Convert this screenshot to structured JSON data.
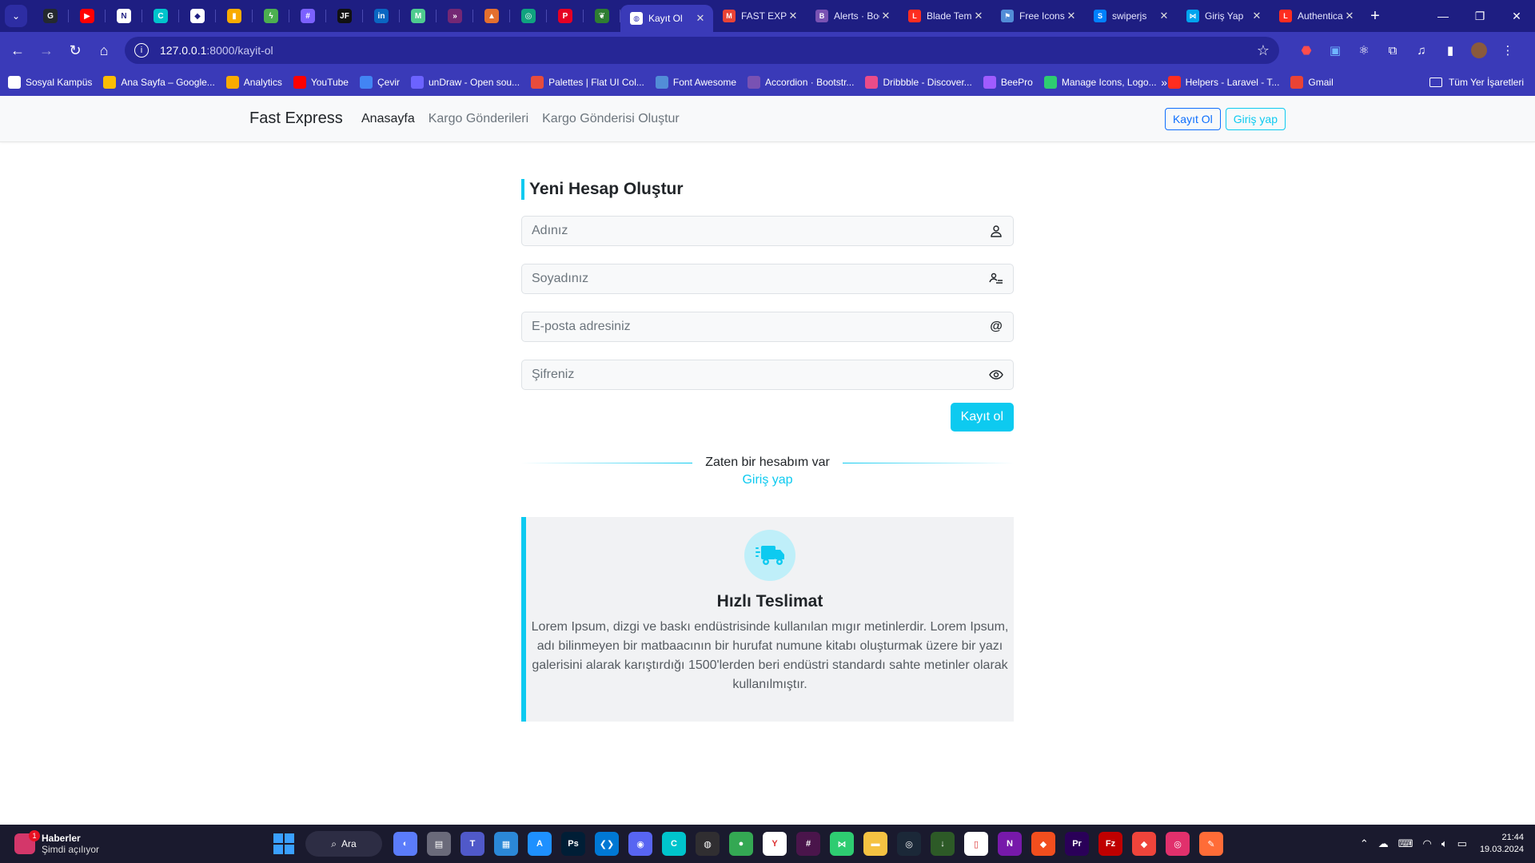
{
  "browser": {
    "pinned_tabs": [
      {
        "icon": "github-icon",
        "color": "#24292f",
        "glyph": "G"
      },
      {
        "icon": "youtube-icon",
        "color": "#ff0000",
        "glyph": "▶"
      },
      {
        "icon": "notion-icon",
        "color": "#ffffff",
        "glyph": "N"
      },
      {
        "icon": "canva-icon",
        "color": "#00c4cc",
        "glyph": "C"
      },
      {
        "icon": "car-icon",
        "color": "#ffffff",
        "glyph": "◆"
      },
      {
        "icon": "analytics-icon",
        "color": "#f9ab00",
        "glyph": "▮"
      },
      {
        "icon": "bolt-icon",
        "color": "#4caf50",
        "glyph": "ϟ"
      },
      {
        "icon": "hashnode-icon",
        "color": "#7b61ff",
        "glyph": "#"
      },
      {
        "icon": "jf-icon",
        "color": "#111111",
        "glyph": "JF"
      },
      {
        "icon": "linkedin-icon",
        "color": "#0a66c2",
        "glyph": "in"
      },
      {
        "icon": "mail-icon",
        "color": "#4ecb8f",
        "glyph": "M"
      },
      {
        "icon": "powerapps-icon",
        "color": "#742774",
        "glyph": "»"
      },
      {
        "icon": "mountain-icon",
        "color": "#e46f2e",
        "glyph": "▲"
      },
      {
        "icon": "chatgpt-icon",
        "color": "#10a37f",
        "glyph": "◎"
      },
      {
        "icon": "pinterest-icon",
        "color": "#e60023",
        "glyph": "P"
      },
      {
        "icon": "leaf-icon",
        "color": "#2e7d32",
        "glyph": "❦"
      }
    ],
    "tabs": [
      {
        "title": "Kayıt Ol",
        "icon": "globe-icon",
        "color": "#ffffff",
        "glyph": "◍",
        "active": true
      },
      {
        "title": "FAST EXPRESS",
        "icon": "gmail-icon",
        "color": "#ea4335",
        "glyph": "M",
        "active": false
      },
      {
        "title": "Alerts · Bootstrap",
        "icon": "bootstrap-icon",
        "color": "#7952b3",
        "glyph": "B",
        "active": false
      },
      {
        "title": "Blade Templates",
        "icon": "laravel-icon",
        "color": "#ff2d20",
        "glyph": "L",
        "active": false
      },
      {
        "title": "Free Icons",
        "icon": "flag-icon",
        "color": "#528dd7",
        "glyph": "⚑",
        "active": false
      },
      {
        "title": "swiperjs",
        "icon": "swiper-icon",
        "color": "#0080ff",
        "glyph": "S",
        "active": false
      },
      {
        "title": "Giriş Yap",
        "icon": "share-icon",
        "color": "#00a4ef",
        "glyph": "⋈",
        "active": false
      },
      {
        "title": "Authentication",
        "icon": "laravel-icon",
        "color": "#ff2d20",
        "glyph": "L",
        "active": false
      }
    ],
    "url_host": "127.0.0.1",
    "url_path": ":8000/kayit-ol",
    "bookmarks": [
      {
        "label": "Sosyal Kampüs",
        "color": "#ffffff"
      },
      {
        "label": "Ana Sayfa – Google...",
        "color": "#fbbc04"
      },
      {
        "label": "Analytics",
        "color": "#f9ab00"
      },
      {
        "label": "YouTube",
        "color": "#ff0000"
      },
      {
        "label": "Çevir",
        "color": "#4285f4"
      },
      {
        "label": "unDraw - Open sou...",
        "color": "#6c63ff"
      },
      {
        "label": "Palettes | Flat UI Col...",
        "color": "#e74c3c"
      },
      {
        "label": "Font Awesome",
        "color": "#528dd7"
      },
      {
        "label": "Accordion · Bootstr...",
        "color": "#7952b3"
      },
      {
        "label": "Dribbble - Discover...",
        "color": "#ea4c89"
      },
      {
        "label": "BeePro",
        "color": "#a05cff"
      },
      {
        "label": "Manage Icons, Logo...",
        "color": "#2ecc71"
      },
      {
        "label": "Helpers - Laravel - T...",
        "color": "#ff2d20"
      },
      {
        "label": "Gmail",
        "color": "#ea4335"
      }
    ],
    "bookmarks_more": "»",
    "all_bookmarks": "Tüm Yer İşaretleri"
  },
  "site": {
    "brand": "Fast Express",
    "nav": [
      {
        "label": "Anasayfa",
        "active": true
      },
      {
        "label": "Kargo Gönderileri",
        "active": false
      },
      {
        "label": "Kargo Gönderisi Oluştur",
        "active": false
      }
    ],
    "register_button": "Kayıt Ol",
    "login_button": "Giriş yap"
  },
  "form": {
    "title": "Yeni Hesap Oluştur",
    "first_name_placeholder": "Adınız",
    "last_name_placeholder": "Soyadınız",
    "email_placeholder": "E-posta adresiniz",
    "password_placeholder": "Şifreniz",
    "submit_label": "Kayıt ol",
    "divider_text": "Zaten bir hesabım var",
    "login_link": "Giriş yap"
  },
  "feature": {
    "title": "Hızlı Teslimat",
    "text": "Lorem Ipsum, dizgi ve baskı endüstrisinde kullanılan mıgır metinlerdir. Lorem Ipsum, adı bilinmeyen bir matbaacının bir hurufat numune kitabı oluşturmak üzere bir yazı galerisini alarak karıştırdığı 1500'lerden beri endüstri standardı sahte metinler olarak kullanılmıştır."
  },
  "taskbar": {
    "widget_title": "Haberler",
    "widget_subtitle": "Şimdi açılıyor",
    "widget_badge": "1",
    "search_label": "Ara",
    "apps": [
      {
        "icon": "copilot-icon",
        "color": "#5b7cfa",
        "glyph": "◐"
      },
      {
        "icon": "file-manager-icon",
        "color": "#6a6a7a",
        "glyph": "▤"
      },
      {
        "icon": "teams-icon",
        "color": "#5059c9",
        "glyph": "T"
      },
      {
        "icon": "store-icon",
        "color": "#2b88d8",
        "glyph": "▦"
      },
      {
        "icon": "appstore-icon",
        "color": "#1e90ff",
        "glyph": "A"
      },
      {
        "icon": "photoshop-icon",
        "color": "#001e36",
        "glyph": "Ps"
      },
      {
        "icon": "vscode-icon",
        "color": "#0078d4",
        "glyph": "❮❯"
      },
      {
        "icon": "discord-icon",
        "color": "#5865f2",
        "glyph": "◉"
      },
      {
        "icon": "canva-icon",
        "color": "#00c4cc",
        "glyph": "C"
      },
      {
        "icon": "obs-icon",
        "color": "#302e31",
        "glyph": "◍"
      },
      {
        "icon": "chrome-icon",
        "color": "#34a853",
        "glyph": "●"
      },
      {
        "icon": "yandex-icon",
        "color": "#ffffff",
        "glyph": "Y"
      },
      {
        "icon": "slack-icon",
        "color": "#4a154b",
        "glyph": "#"
      },
      {
        "icon": "share-icon",
        "color": "#2ecc71",
        "glyph": "⋈"
      },
      {
        "icon": "folder-icon",
        "color": "#f5c242",
        "glyph": "▬"
      },
      {
        "icon": "steam-icon",
        "color": "#1b2838",
        "glyph": "◎"
      },
      {
        "icon": "download-icon",
        "color": "#2d5a27",
        "glyph": "↓"
      },
      {
        "icon": "notepad-icon",
        "color": "#ffffff",
        "glyph": "▯"
      },
      {
        "icon": "onenote-icon",
        "color": "#7719aa",
        "glyph": "N"
      },
      {
        "icon": "figma-icon",
        "color": "#f24e1e",
        "glyph": "◆"
      },
      {
        "icon": "premiere-icon",
        "color": "#2a0058",
        "glyph": "Pr"
      },
      {
        "icon": "filezilla-icon",
        "color": "#bf0000",
        "glyph": "Fz"
      },
      {
        "icon": "anydesk-icon",
        "color": "#ef443b",
        "glyph": "◆"
      },
      {
        "icon": "instagram-icon",
        "color": "#e1306c",
        "glyph": "◎"
      },
      {
        "icon": "postman-icon",
        "color": "#ff6c37",
        "glyph": "✎"
      }
    ],
    "time": "21:44",
    "date": "19.03.2024"
  },
  "colors": {
    "info": "#0dcaf0",
    "primary": "#0d6efd",
    "browser_bg": "#3a3ab8"
  }
}
